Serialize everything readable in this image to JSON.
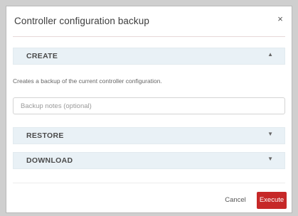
{
  "dialog": {
    "title": "Controller configuration backup",
    "close_symbol": "×"
  },
  "sections": [
    {
      "label": "CREATE",
      "arrow": "▲",
      "expanded": true
    },
    {
      "label": "RESTORE",
      "arrow": "▼",
      "expanded": false
    },
    {
      "label": "DOWNLOAD",
      "arrow": "▼",
      "expanded": false
    }
  ],
  "create": {
    "description": "Creates a backup of the current controller configuration.",
    "notes_placeholder": "Backup notes (optional)",
    "notes_value": ""
  },
  "footer": {
    "cancel_label": "Cancel",
    "execute_label": "Execute"
  },
  "colors": {
    "accent": "#c62828",
    "section_bg": "#e9f1f6"
  }
}
